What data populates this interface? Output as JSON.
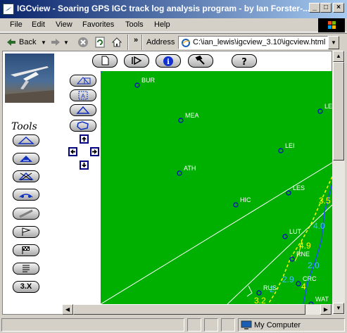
{
  "window": {
    "title": "IGCview - Soaring GPS IGC track log analysis program - by Ian Forster-..."
  },
  "menu": {
    "items": [
      "File",
      "Edit",
      "View",
      "Favorites",
      "Tools",
      "Help"
    ]
  },
  "toolbar": {
    "back_label": "Back",
    "address_label": "Address",
    "address_value": "C:\\ian_lewis\\igcview_3.10\\igcview.html"
  },
  "page": {
    "tools_title": "Tools",
    "speed_button_label": "3.X",
    "info_icon_glyph": "i",
    "help_icon_glyph": "?"
  },
  "map": {
    "background_color": "#00b000",
    "turnpoint_color": "#0000cc",
    "track_color": "#ffff00",
    "turnpoints": [
      {
        "label": "BUR"
      },
      {
        "label": "MEA"
      },
      {
        "label": "LEN"
      },
      {
        "label": "LEI"
      },
      {
        "label": "ATH"
      },
      {
        "label": "LES"
      },
      {
        "label": "HIC"
      },
      {
        "label": "LUT"
      },
      {
        "label": "RNE"
      },
      {
        "label": "CRC"
      },
      {
        "label": "RUS"
      },
      {
        "label": "WAT"
      }
    ],
    "altitude_labels": [
      "3.5",
      "4.0",
      "4.9",
      "2.0",
      "4",
      "2",
      "3.2",
      "2.9"
    ]
  },
  "status": {
    "text": "My Computer"
  }
}
